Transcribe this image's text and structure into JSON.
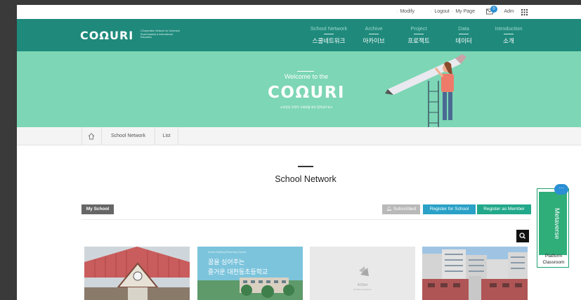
{
  "utility": {
    "modify": "Modify",
    "logout": "Logout",
    "mypage": "My Page",
    "message_count": "0",
    "admin": "Adm"
  },
  "header": {
    "logo": "COΩURI",
    "logo_sub": "COoperative Network for Universal Road towards a International Education",
    "nav": [
      {
        "en": "School Network",
        "ko": "스쿨네트워크"
      },
      {
        "en": "Archive",
        "ko": "아카이브"
      },
      {
        "en": "Project",
        "ko": "프로젝트"
      },
      {
        "en": "Data",
        "ko": "데이터"
      },
      {
        "en": "Introduction",
        "ko": "소개"
      }
    ]
  },
  "hero": {
    "welcome": "Welcome to the",
    "logo": "COΩURI",
    "tagline": "교육현장 보편적 국제화를 위한 협력네트워크"
  },
  "breadcrumb": {
    "items": [
      "School Network",
      "List"
    ]
  },
  "page": {
    "title": "School Network"
  },
  "toolbar": {
    "my_school": "My School",
    "subscribed": "Subscribed",
    "register_school": "Register for School",
    "register_member": "Register as Member"
  },
  "cards": [
    {
      "image": "school-building-red-roof"
    },
    {
      "banner_small": "Dream Building Elementary School",
      "banner_line1": "꿈을 심어주는",
      "banner_line2": "즐거운 대천동초등학교"
    },
    {
      "name": "ASNet",
      "sub": "All School Network"
    },
    {
      "image": "school-building-apartments"
    }
  ],
  "side_widget": {
    "vertical": "Metaverse",
    "bubble": "···",
    "line1": "Platform",
    "line2": "Classroom"
  },
  "colors": {
    "header_bg": "#1f8a7c",
    "hero_bg": "#7dd6b5",
    "subscribed_bg": "#b9b9b9",
    "register_school_bg": "#2aa1c7",
    "register_member_bg": "#22a88a",
    "badge": "#2a8fd4"
  }
}
